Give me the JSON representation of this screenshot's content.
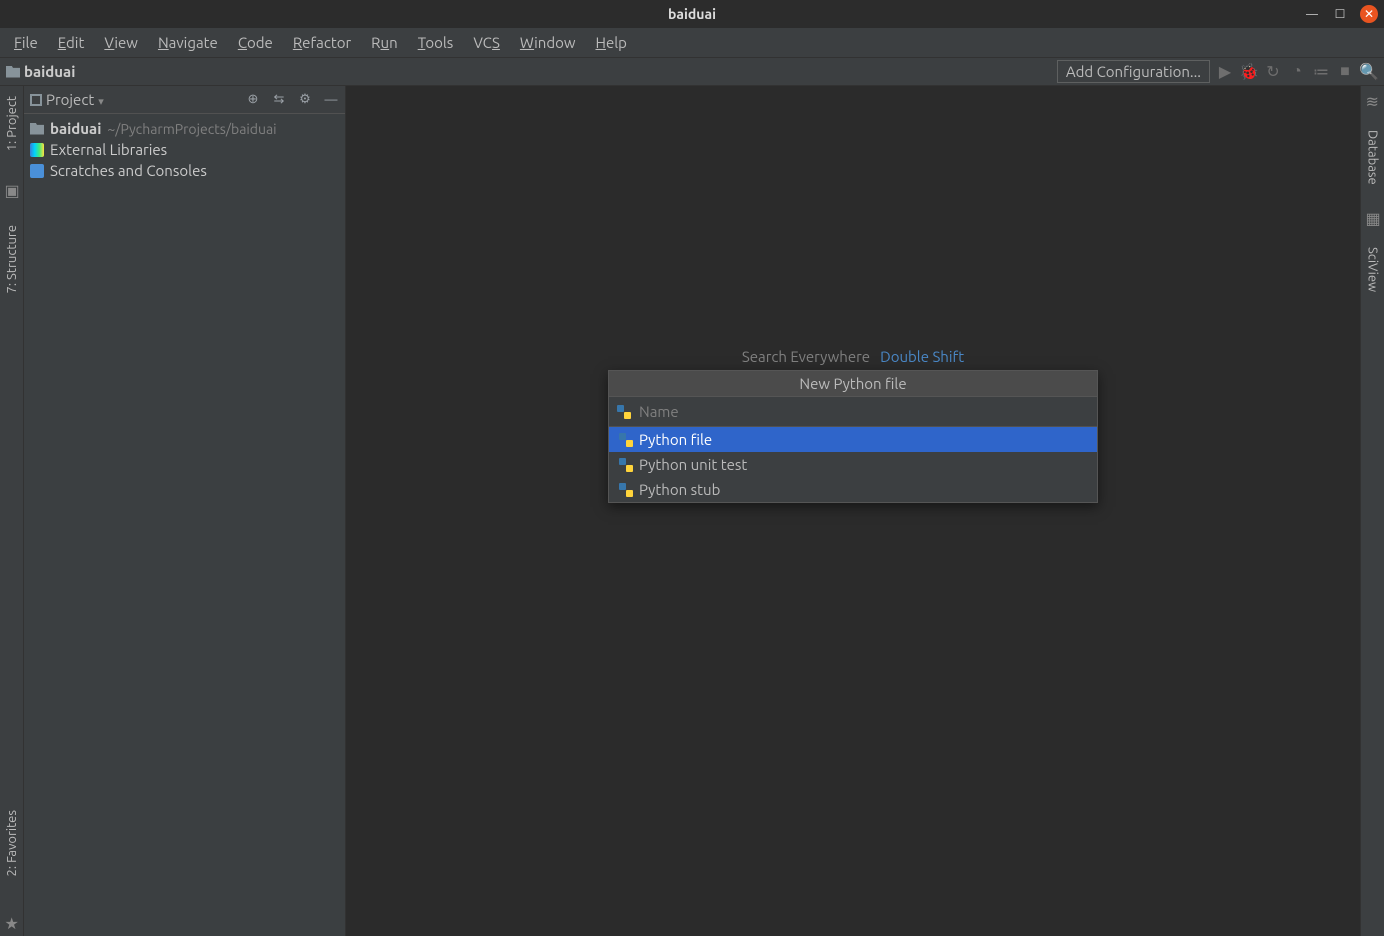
{
  "window": {
    "title": "baiduai"
  },
  "menu": {
    "items": [
      "File",
      "Edit",
      "View",
      "Navigate",
      "Code",
      "Refactor",
      "Run",
      "Tools",
      "VCS",
      "Window",
      "Help"
    ]
  },
  "breadcrumb": {
    "project": "baiduai"
  },
  "toolbar": {
    "add_config": "Add Configuration..."
  },
  "left_gutter": {
    "project": "1: Project",
    "structure": "7: Structure",
    "favorites": "2: Favorites"
  },
  "right_gutter": {
    "database": "Database",
    "sciview": "SciView"
  },
  "project_panel": {
    "title": "Project",
    "root": "baiduai",
    "root_path": "~/PycharmProjects/baiduai",
    "external_libs": "External Libraries",
    "scratches": "Scratches and Consoles"
  },
  "editor_hint": {
    "label": "Search Everywhere",
    "shortcut": "Double Shift"
  },
  "popup": {
    "title": "New Python file",
    "placeholder": "Name",
    "options": [
      "Python file",
      "Python unit test",
      "Python stub"
    ],
    "selected_index": 0
  }
}
